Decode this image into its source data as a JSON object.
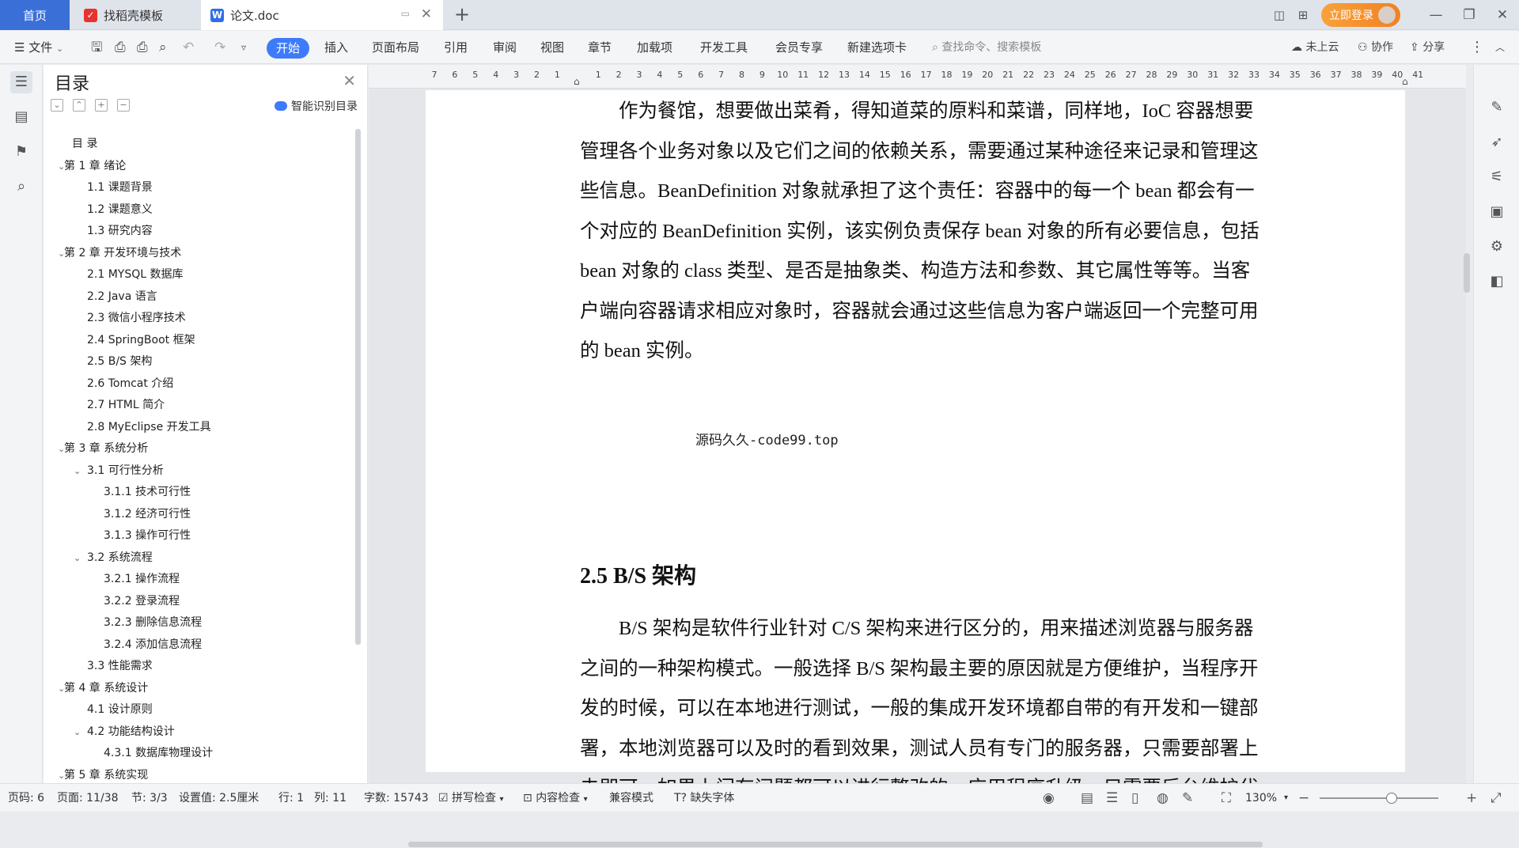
{
  "titlebar": {
    "tabs": [
      {
        "label": "首页"
      },
      {
        "label": "找稻壳模板"
      },
      {
        "label": "论文.doc"
      }
    ],
    "login_label": "立即登录"
  },
  "menubar": {
    "file_label": "文件",
    "items": [
      "开始",
      "插入",
      "页面布局",
      "引用",
      "审阅",
      "视图",
      "章节",
      "加载项",
      "开发工具",
      "会员专享",
      "新建选项卡"
    ],
    "search_placeholder": "查找命令、搜索模板",
    "cloud_label": "未上云",
    "collab_label": "协作",
    "share_label": "分享"
  },
  "nav": {
    "title": "目录",
    "smart_label": "智能识别目录",
    "toc": [
      {
        "text": "目  录",
        "level": 0,
        "caret": false
      },
      {
        "text": "第 1 章  绪论",
        "level": 0,
        "caret": true
      },
      {
        "text": "1.1  课题背景",
        "level": 1,
        "caret": false
      },
      {
        "text": "1.2  课题意义",
        "level": 1,
        "caret": false
      },
      {
        "text": "1.3  研究内容",
        "level": 1,
        "caret": false
      },
      {
        "text": "第 2 章  开发环境与技术",
        "level": 0,
        "caret": true
      },
      {
        "text": "2.1 MYSQL 数据库",
        "level": 1,
        "caret": false
      },
      {
        "text": "2.2 Java 语言",
        "level": 1,
        "caret": false
      },
      {
        "text": "2.3  微信小程序技术",
        "level": 1,
        "caret": false
      },
      {
        "text": "2.4 SpringBoot 框架",
        "level": 1,
        "caret": false
      },
      {
        "text": "2.5 B/S 架构",
        "level": 1,
        "caret": false
      },
      {
        "text": "2.6 Tomcat  介绍",
        "level": 1,
        "caret": false
      },
      {
        "text": "2.7 HTML 简介",
        "level": 1,
        "caret": false
      },
      {
        "text": "2.8 MyEclipse 开发工具",
        "level": 1,
        "caret": false
      },
      {
        "text": "第 3 章  系统分析",
        "level": 0,
        "caret": true
      },
      {
        "text": "3.1  可行性分析",
        "level": 1,
        "caret": true
      },
      {
        "text": "3.1.1  技术可行性",
        "level": 2,
        "caret": false
      },
      {
        "text": "3.1.2  经济可行性",
        "level": 2,
        "caret": false
      },
      {
        "text": "3.1.3  操作可行性",
        "level": 2,
        "caret": false
      },
      {
        "text": "3.2  系统流程",
        "level": 1,
        "caret": true
      },
      {
        "text": "3.2.1  操作流程",
        "level": 2,
        "caret": false
      },
      {
        "text": "3.2.2  登录流程",
        "level": 2,
        "caret": false
      },
      {
        "text": "3.2.3  删除信息流程",
        "level": 2,
        "caret": false
      },
      {
        "text": "3.2.4  添加信息流程",
        "level": 2,
        "caret": false
      },
      {
        "text": "3.3  性能需求",
        "level": 1,
        "caret": false
      },
      {
        "text": "第 4 章  系统设计",
        "level": 0,
        "caret": true
      },
      {
        "text": "4.1  设计原则",
        "level": 1,
        "caret": false
      },
      {
        "text": "4.2  功能结构设计",
        "level": 1,
        "caret": true
      },
      {
        "text": "4.3.1  数据库物理设计",
        "level": 2,
        "caret": false
      },
      {
        "text": "第 5 章  系统实现",
        "level": 0,
        "caret": true
      }
    ]
  },
  "ruler": {
    "ticks": [
      "7",
      "6",
      "5",
      "4",
      "3",
      "2",
      "1",
      "",
      "1",
      "2",
      "3",
      "4",
      "5",
      "6",
      "7",
      "8",
      "9",
      "10",
      "11",
      "12",
      "13",
      "14",
      "15",
      "16",
      "17",
      "18",
      "19",
      "20",
      "21",
      "22",
      "23",
      "24",
      "25",
      "26",
      "27",
      "28",
      "29",
      "30",
      "31",
      "32",
      "33",
      "34",
      "35",
      "36",
      "37",
      "38",
      "39",
      "40",
      "41"
    ]
  },
  "doc": {
    "para1": [
      "　　作为餐馆，想要做出菜肴，得知道菜的原料和菜谱，同样地，IoC 容器想要",
      "管理各个业务对象以及它们之间的依赖关系，需要通过某种途径来记录和管理这",
      "些信息。BeanDefinition 对象就承担了这个责任：容器中的每一个 bean 都会有一",
      "个对应的 BeanDefinition 实例，该实例负责保存 bean 对象的所有必要信息，包括",
      "bean 对象的 class 类型、是否是抽象类、构造方法和参数、其它属性等等。当客",
      "户端向容器请求相应对象时，容器就会通过这些信息为客户端返回一个完整可用",
      "的 bean 实例。"
    ],
    "watermark": "源码久久-code99.top",
    "heading": "2.5 B/S 架构",
    "para2": [
      "　　B/S 架构是软件行业针对 C/S 架构来进行区分的，用来描述浏览器与服务器",
      "之间的一种架构模式。一般选择 B/S 架构最主要的原因就是方便维护，当程序开",
      "发的时候，可以在本地进行测试，一般的集成开发环境都自带的有开发和一键部",
      "署，本地浏览器可以及时的看到效果，测试人员有专门的服务器，只需要部署上",
      "去即可，如果上门有问题都可以进行整改的，应用程序升级，只需要后台维护代"
    ]
  },
  "status": {
    "page_no": "页码: 6",
    "page_of": "页面: 11/38",
    "section": "节: 3/3",
    "setting": "设置值: 2.5厘米",
    "row": "行: 1",
    "col": "列: 11",
    "word_count": "字数: 15743",
    "spell_check": "拼写检查",
    "content_check": "内容检查",
    "compat_mode": "兼容模式",
    "missing_font": "缺失字体",
    "zoom": "130%"
  },
  "colors": {
    "accent": "#3e7bfa",
    "home_tab": "#3b6fd8",
    "login": "#f38020"
  }
}
